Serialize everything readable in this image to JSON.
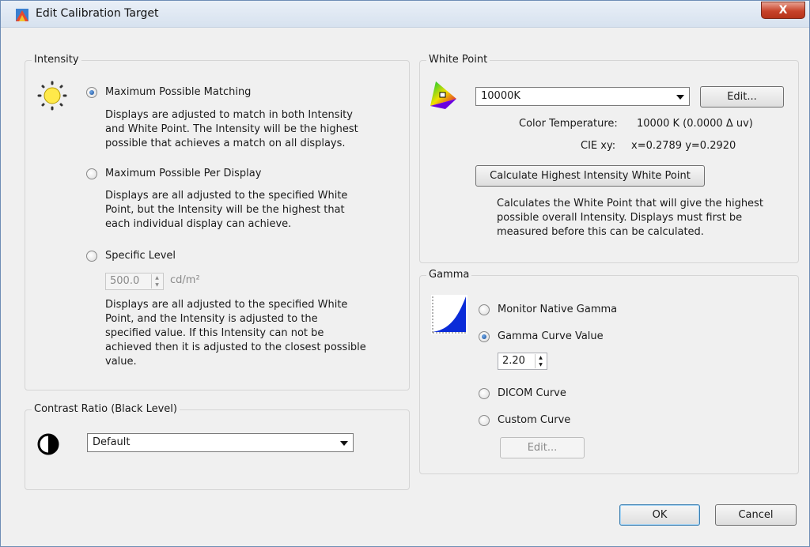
{
  "window": {
    "title": "Edit Calibration Target",
    "close_label": "X"
  },
  "intensity": {
    "group_title": "Intensity",
    "options": [
      {
        "label": "Maximum Possible Matching",
        "checked": true,
        "desc": [
          "Displays are adjusted to match in both Intensity",
          "and White Point. The Intensity will be the highest",
          "possible that achieves a match on all displays."
        ]
      },
      {
        "label": "Maximum Possible Per Display",
        "checked": false,
        "desc": [
          "Displays are all adjusted to the specified White",
          "Point, but the Intensity will be the highest that",
          "each individual display can achieve."
        ]
      },
      {
        "label": "Specific Level",
        "checked": false,
        "desc": [
          "Displays are all adjusted to the specified White",
          "Point, and the Intensity is adjusted to the",
          "specified value. If this Intensity can not be",
          "achieved then it is adjusted to the closest possible",
          "value."
        ]
      }
    ],
    "level_value": "500.0",
    "level_unit": "cd/m²"
  },
  "contrast": {
    "group_title": "Contrast Ratio (Black Level)",
    "selected": "Default"
  },
  "white_point": {
    "group_title": "White Point",
    "selected": "10000K",
    "edit_label": "Edit...",
    "color_temp_label": "Color Temperature:",
    "color_temp_value": "10000 K (0.0000 Δ uv)",
    "cie_label": "CIE xy:",
    "cie_value": "x=0.2789 y=0.2920",
    "calc_button": "Calculate Highest Intensity White Point",
    "calc_desc": [
      "Calculates the White Point that will give the highest",
      "possible overall Intensity. Displays must first be",
      "measured before this can be calculated."
    ]
  },
  "gamma": {
    "group_title": "Gamma",
    "options": [
      {
        "label": "Monitor Native Gamma",
        "checked": false
      },
      {
        "label": "Gamma Curve Value",
        "checked": true
      },
      {
        "label": "DICOM Curve",
        "checked": false
      },
      {
        "label": "Custom Curve",
        "checked": false
      }
    ],
    "value": "2.20",
    "edit_label": "Edit..."
  },
  "footer": {
    "ok_label": "OK",
    "cancel_label": "Cancel"
  },
  "colors": {
    "accent": "#1b4e96",
    "close": "#c7432a"
  }
}
